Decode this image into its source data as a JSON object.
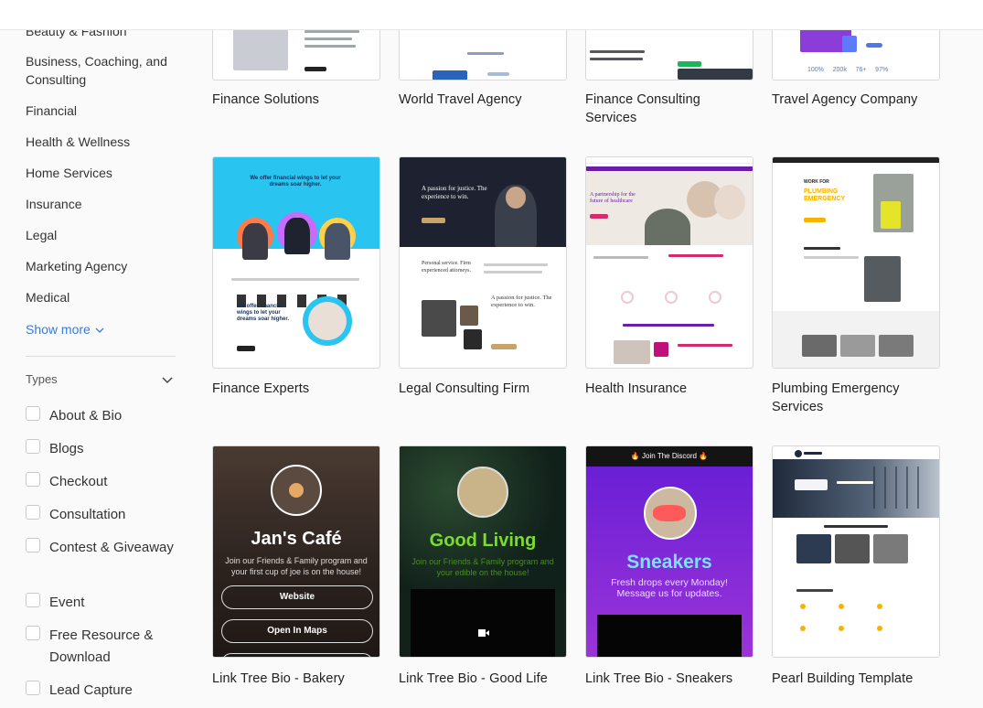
{
  "sidebar": {
    "categories": [
      "Beauty & Fashion",
      "Business, Coaching, and Consulting",
      "Financial",
      "Health & Wellness",
      "Home Services",
      "Insurance",
      "Legal",
      "Marketing Agency",
      "Medical"
    ],
    "show_more": "Show more",
    "types_label": "Types",
    "types": [
      "About & Bio",
      "Blogs",
      "Checkout",
      "Consultation",
      "Contest & Giveaway",
      "Event",
      "Free Resource & Download",
      "Lead Capture"
    ]
  },
  "templates": [
    {
      "title": "Finance Solutions"
    },
    {
      "title": "World Travel Agency"
    },
    {
      "title": "Finance Consulting Services"
    },
    {
      "title": "Travel Agency Company"
    },
    {
      "title": "Finance Experts"
    },
    {
      "title": "Legal Consulting Firm"
    },
    {
      "title": "Health Insurance"
    },
    {
      "title": "Plumbing Emergency Services"
    },
    {
      "title": "Link Tree Bio - Bakery"
    },
    {
      "title": "Link Tree Bio - Good Life"
    },
    {
      "title": "Link Tree Bio - Sneakers"
    },
    {
      "title": "Pearl Building Template"
    }
  ],
  "previews": {
    "finance_experts_headline": "We offer financial wings to let your dreams soar higher.",
    "legal_headline": "A passion for justice. The experience to win.",
    "health_headline": "A partnership for the future of healthcare",
    "plumbing_work_for": "WORK FOR",
    "plumbing_headline": "PLUMBING EMERGENCY",
    "travel_stats": [
      "100%",
      "200k",
      "76+",
      "97%"
    ],
    "bakery_name": "Jan's Café",
    "bakery_sub": "Join our Friends & Family program and your first cup of joe is on the house!",
    "bakery_btn1": "Website",
    "bakery_btn2": "Open In Maps",
    "goodliving_name": "Good Living",
    "goodliving_sub": "Join our Friends & Family program and your edible on the house!",
    "sneakers_banner": "🔥 Join The Discord 🔥",
    "sneakers_name": "Sneakers",
    "sneakers_sub": "Fresh drops every Monday! Message us for updates."
  },
  "colors": {
    "accent_link": "#3a7bd5",
    "finance_experts_bg": "#29c4f0",
    "legal_dark": "#1d2130",
    "health_purple": "#6b1fa8",
    "plumbing_yellow": "#f5b400",
    "goodliving_green": "#7bdc2b",
    "sneakers_purple": "#7a2ad6",
    "pearl_dark": "#1f2a3c"
  }
}
